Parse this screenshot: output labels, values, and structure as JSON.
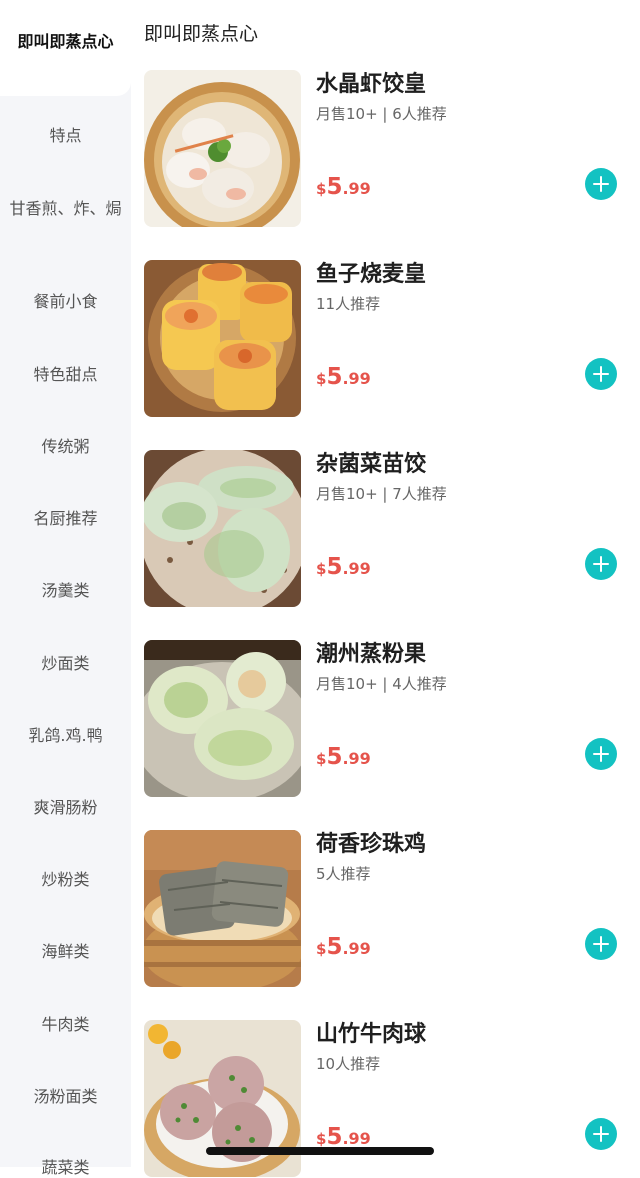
{
  "sidebar": {
    "active": "即叫即蒸点心",
    "items": [
      "特点",
      "甘香煎、炸、焗",
      "餐前小食",
      "特色甜点",
      "传统粥",
      "名厨推荐",
      "汤羹类",
      "炒面类",
      "乳鸽.鸡.鸭",
      "爽滑肠粉",
      "炒粉类",
      "海鲜类",
      "牛肉类",
      "汤粉面类",
      "蔬菜类"
    ]
  },
  "section": {
    "title": "即叫即蒸点心"
  },
  "dishes": [
    {
      "name": "水晶虾饺皇",
      "meta": "月售10+ | 6人推荐",
      "currency": "$",
      "price_int": "5",
      "price_dec": ".99",
      "photo": "crystal-shrimp-dumpling"
    },
    {
      "name": "鱼子烧麦皇",
      "meta": "11人推荐",
      "currency": "$",
      "price_int": "5",
      "price_dec": ".99",
      "photo": "siu-mai"
    },
    {
      "name": "杂菌菜苗饺",
      "meta": "月售10+ | 7人推荐",
      "currency": "$",
      "price_int": "5",
      "price_dec": ".99",
      "photo": "vegetable-dumpling"
    },
    {
      "name": "潮州蒸粉果",
      "meta": "月售10+ | 4人推荐",
      "currency": "$",
      "price_int": "5",
      "price_dec": ".99",
      "photo": "chiuchow-dumpling"
    },
    {
      "name": "荷香珍珠鸡",
      "meta": "5人推荐",
      "currency": "$",
      "price_int": "5",
      "price_dec": ".99",
      "photo": "lotus-leaf-rice"
    },
    {
      "name": "山竹牛肉球",
      "meta": "10人推荐",
      "currency": "$",
      "price_int": "5",
      "price_dec": ".99",
      "photo": "beef-balls"
    }
  ],
  "colors": {
    "accent": "#13c2c2",
    "price": "#e5534b",
    "sidebar_bg": "#f5f6f9"
  },
  "icons": {
    "add": "plus-circle-icon"
  }
}
